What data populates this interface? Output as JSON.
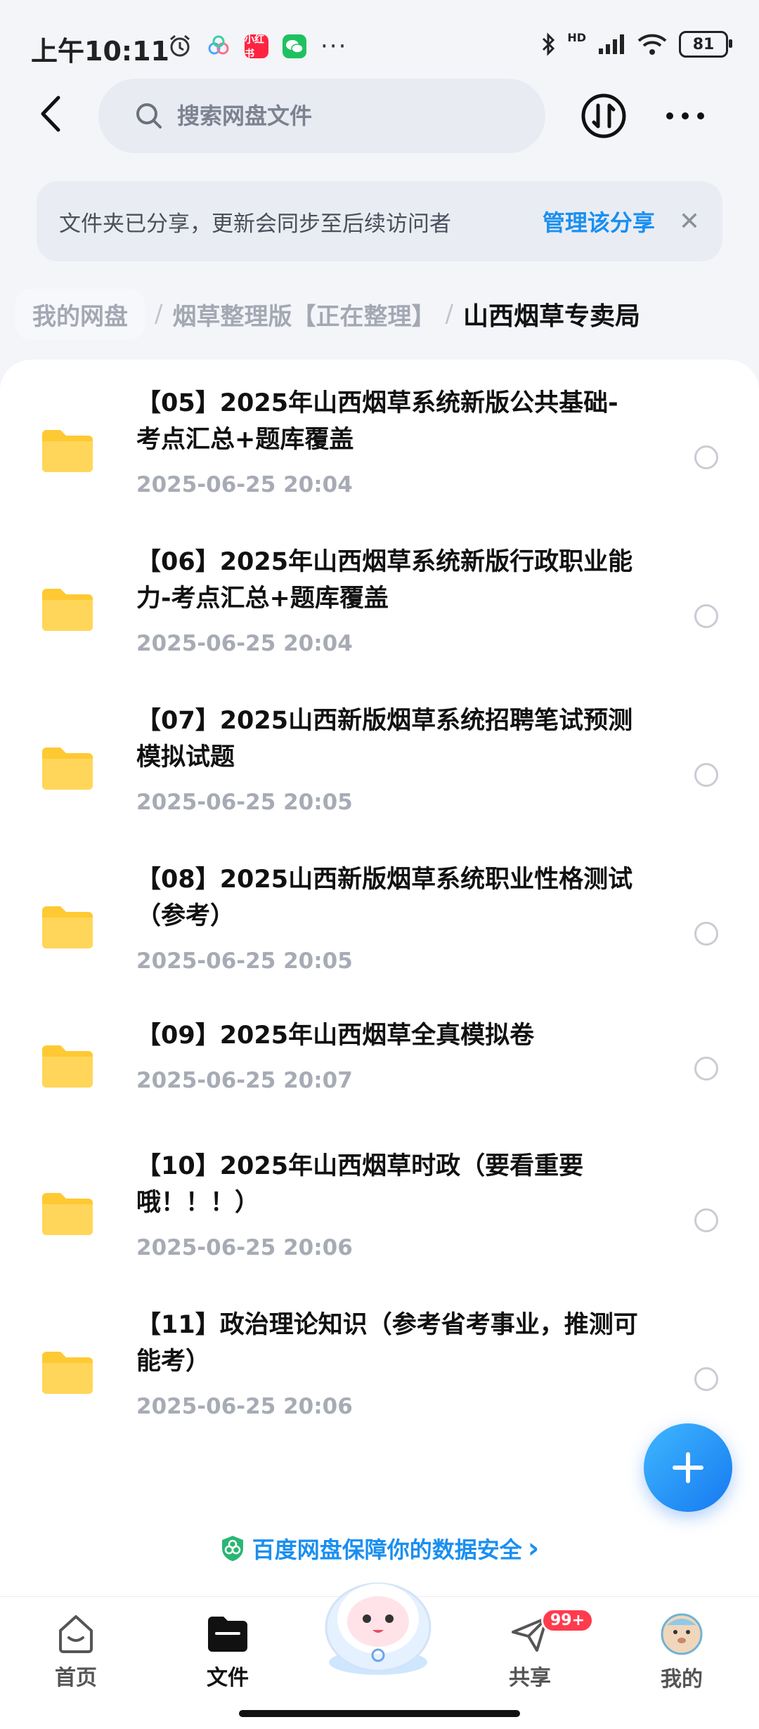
{
  "status_bar": {
    "time": "上午10:11",
    "app_label_red": "小红书",
    "dots": "···",
    "network": "HD",
    "battery": "81"
  },
  "header": {
    "search_placeholder": "搜索网盘文件"
  },
  "banner": {
    "text": "文件夹已分享，更新会同步至后续访问者",
    "link": "管理该分享",
    "close": "✕"
  },
  "breadcrumb": {
    "root": "我的网盘",
    "mid": "烟草整理版【正在整理】",
    "current": "山西烟草专卖局",
    "separator": "/"
  },
  "files": [
    {
      "title": "【05】2025年山西烟草系统新版公共基础-考点汇总+题库覆盖",
      "date": "2025-06-25  20:04"
    },
    {
      "title": "【06】2025年山西烟草系统新版行政职业能力-考点汇总+题库覆盖",
      "date": "2025-06-25  20:04"
    },
    {
      "title": "【07】2025山西新版烟草系统招聘笔试预测模拟试题",
      "date": "2025-06-25  20:05"
    },
    {
      "title": "【08】2025山西新版烟草系统职业性格测试（参考）",
      "date": "2025-06-25  20:05"
    },
    {
      "title": "【09】2025年山西烟草全真模拟卷",
      "date": "2025-06-25  20:07"
    },
    {
      "title": "【10】2025年山西烟草时政（要看重要哦！！！）",
      "date": "2025-06-25  20:06"
    },
    {
      "title": "【11】政治理论知识（参考省考事业，推测可能考）",
      "date": "2025-06-25  20:06"
    }
  ],
  "security": {
    "text": "百度网盘保障你的数据安全",
    "chevron": "›"
  },
  "nav": {
    "home": "首页",
    "files": "文件",
    "share": "共享",
    "share_badge": "99+",
    "mine": "我的"
  },
  "colors": {
    "accent": "#1a8ff0",
    "folder": "#ffc933",
    "badge": "#ff3b4e"
  }
}
